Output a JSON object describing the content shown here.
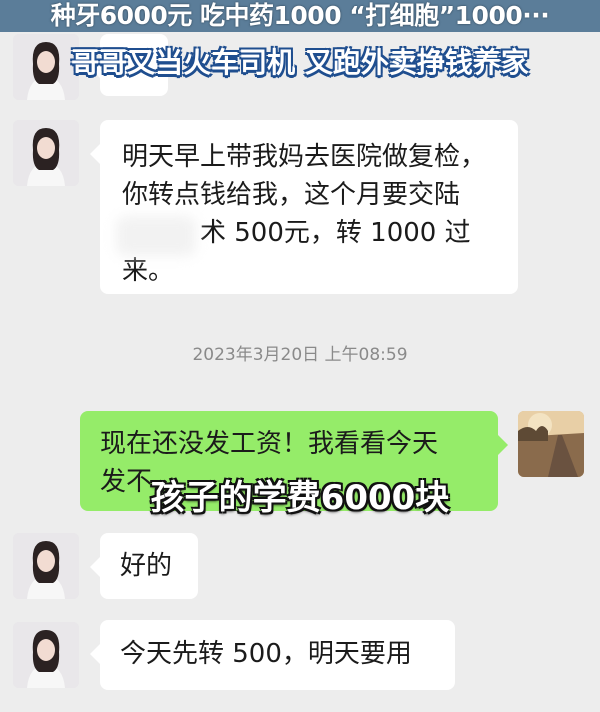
{
  "headline": {
    "top": "种牙6000元 吃中药1000 “打细胞”1000···",
    "sub": "哥哥又当火车司机 又跑外卖挣钱养家"
  },
  "messages": [
    {
      "side": "left",
      "text": ""
    },
    {
      "side": "left",
      "lines": [
        "明天早上带我妈去医院做复检，",
        "你转点钱给我，这个月要交陆",
        "术 500元，转 1000 过",
        "来。"
      ]
    },
    {
      "side": "right",
      "lines": [
        "现在还没发工资！我看看今天",
        "发不"
      ]
    },
    {
      "side": "left",
      "text": "好的"
    },
    {
      "side": "left",
      "text": "今天先转 500，明天要用"
    }
  ],
  "timestamp": "2023年3月20日 上午08:59",
  "caption": "孩子的学费6000块",
  "colors": {
    "chat_bg": "#ededed",
    "bubble_self": "#95ec69",
    "bubble_other": "#ffffff",
    "headline_sub_outline": "#1f4e8f"
  },
  "icons": {
    "left_avatar": "woman-portrait-avatar",
    "right_avatar": "railway-landscape-avatar"
  }
}
